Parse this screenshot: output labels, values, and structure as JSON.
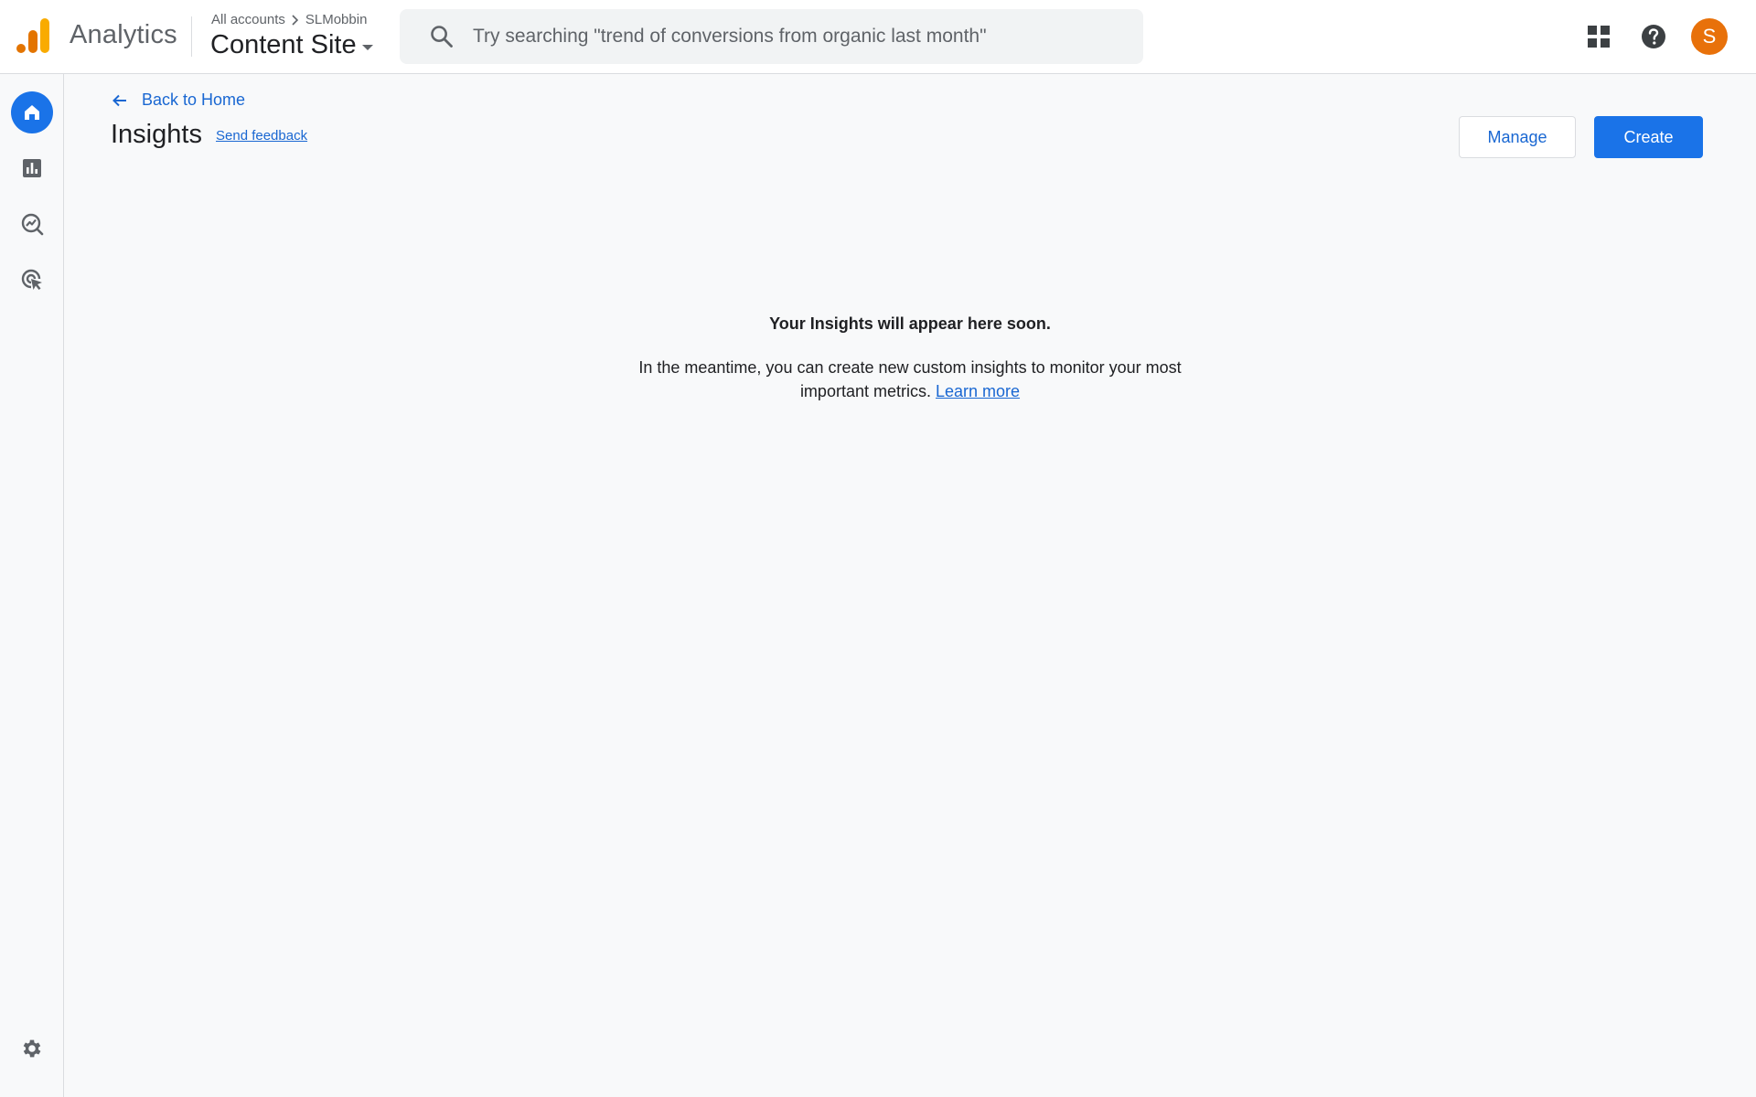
{
  "header": {
    "product_name": "Analytics",
    "breadcrumb": {
      "accounts": "All accounts",
      "account": "SLMobbin"
    },
    "property_name": "Content Site",
    "search_placeholder": "Try searching \"trend of conversions from organic last month\"",
    "avatar_letter": "S"
  },
  "rail": {
    "items": [
      {
        "icon": "home-icon",
        "active": true
      },
      {
        "icon": "reports-icon",
        "active": false
      },
      {
        "icon": "explore-icon",
        "active": false
      },
      {
        "icon": "advertising-icon",
        "active": false
      }
    ],
    "bottom": {
      "icon": "admin-gear-icon"
    }
  },
  "page": {
    "back_label": "Back to Home",
    "title": "Insights",
    "feedback_label": "Send feedback",
    "manage_label": "Manage",
    "create_label": "Create"
  },
  "empty_state": {
    "title": "Your Insights will appear here soon.",
    "body": "In the meantime, you can create new custom insights to monitor your most important metrics.",
    "link": "Learn more"
  },
  "colors": {
    "accent": "#1a73e8",
    "link": "#1967d2",
    "avatar": "#e8710a",
    "logo_dark": "#e37400",
    "logo_light": "#f9ab00"
  }
}
